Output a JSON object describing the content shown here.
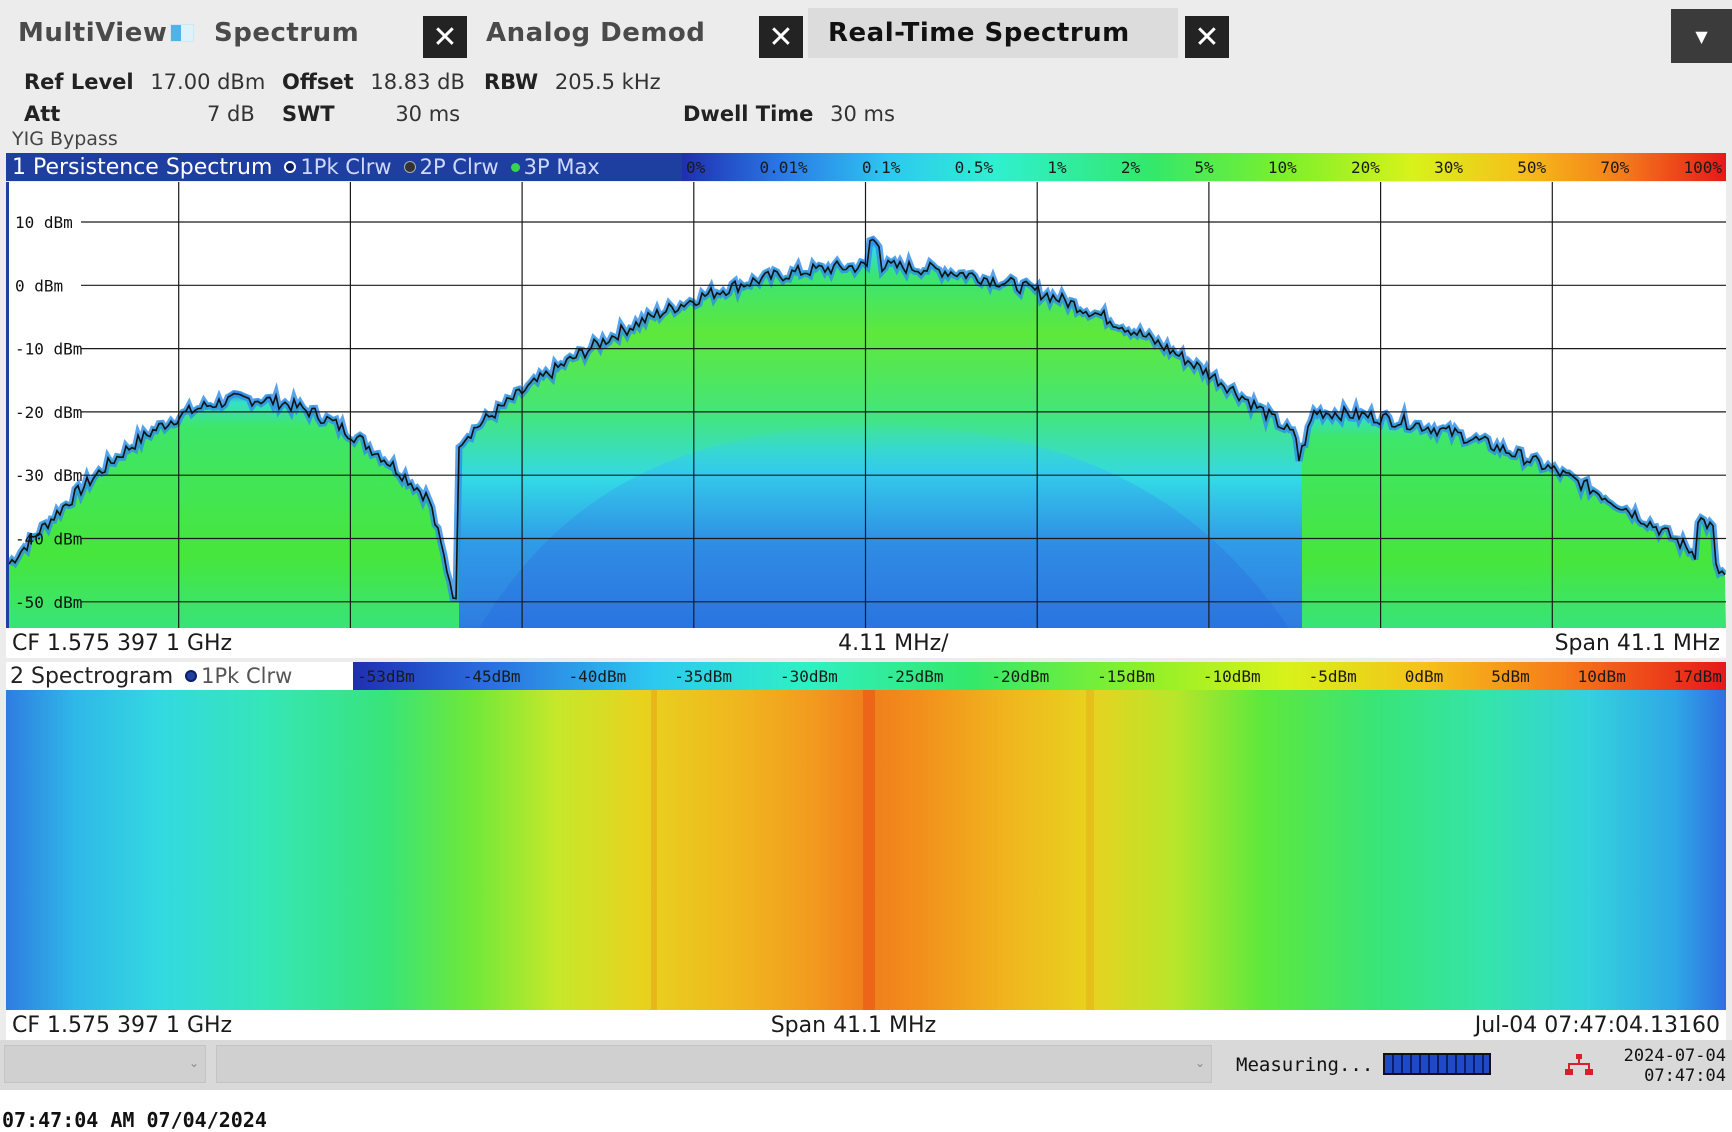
{
  "tabs": [
    {
      "label": "MultiView",
      "active": false
    },
    {
      "label": "Spectrum",
      "active": false
    },
    {
      "label": "Analog Demod",
      "active": false
    },
    {
      "label": "Real-Time Spectrum",
      "active": true
    }
  ],
  "settings": {
    "ref_level_label": "Ref Level",
    "ref_level_value": "17.00 dBm",
    "offset_label": "Offset",
    "offset_value": "18.83 dB",
    "rbw_label": "RBW",
    "rbw_value": "205.5 kHz",
    "att_label": "Att",
    "att_value": "7 dB",
    "swt_label": "SWT",
    "swt_value": "30 ms",
    "dwell_label": "Dwell Time",
    "dwell_value": "30 ms",
    "yig": "YIG Bypass"
  },
  "window1": {
    "title": "1 Persistence Spectrum",
    "traces": [
      {
        "label": "1Pk Clrw",
        "color": "#0b1f66"
      },
      {
        "label": "2P Clrw",
        "color": "#333333"
      },
      {
        "label": "3P Max",
        "color": "#39d353"
      }
    ],
    "colorbar": [
      "0%",
      "0.01%",
      "0.1%",
      "0.5%",
      "1%",
      "2%",
      "5%",
      "10%",
      "20%",
      "30%",
      "50%",
      "70%",
      "100%"
    ],
    "y_ticks": [
      "10 dBm",
      "0 dBm",
      "-10 dBm",
      "-20 dBm",
      "-30 dBm",
      "-40 dBm",
      "-50 dBm"
    ],
    "footer": {
      "cf": "CF 1.575 397 1 GHz",
      "div": "4.11 MHz/",
      "span": "Span 41.1 MHz"
    }
  },
  "window2": {
    "title": "2 Spectrogram",
    "trace": "1Pk Clrw",
    "colorbar": [
      "-53dBm",
      "-45dBm",
      "-40dBm",
      "-35dBm",
      "-30dBm",
      "-25dBm",
      "-20dBm",
      "-15dBm",
      "-10dBm",
      "-5dBm",
      "0dBm",
      "5dBm",
      "10dBm",
      "17dBm"
    ],
    "footer": {
      "cf": "CF 1.575 397 1 GHz",
      "span": "Span 41.1 MHz",
      "time": "Jul-04 07:47:04.13160"
    }
  },
  "status": {
    "measuring": "Measuring...",
    "date": "2024-07-04",
    "time": "07:47:04"
  },
  "capture_stamp": "07:47:04 AM   07/04/2024",
  "colors": {
    "title_bar": "#1f3fa0",
    "trace_line": "#0b1f66",
    "persistence_blue": "#2f7ce0"
  }
}
